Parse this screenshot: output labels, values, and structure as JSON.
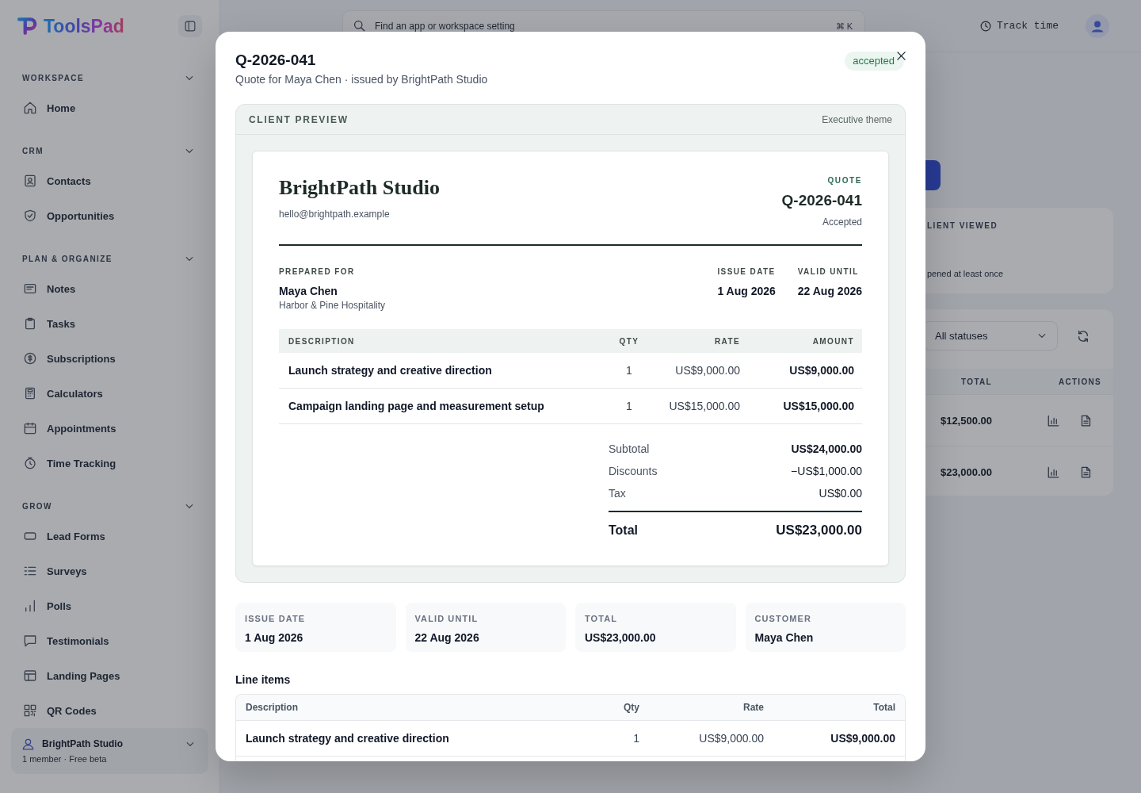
{
  "app": {
    "sidebar": {
      "logo": "ToolsPad",
      "sections": [
        {
          "title": "WORKSPACE",
          "items": [
            {
              "label": "Home",
              "selected": false
            }
          ]
        },
        {
          "title": "CRM",
          "items": [
            {
              "label": "Contacts",
              "selected": false
            },
            {
              "label": "Opportunities",
              "selected": false
            }
          ]
        },
        {
          "title": "PLAN & ORGANIZE",
          "items": [
            {
              "label": "Notes",
              "selected": false
            },
            {
              "label": "Tasks",
              "selected": false
            },
            {
              "label": "Subscriptions",
              "selected": false
            },
            {
              "label": "Calculators",
              "selected": false
            },
            {
              "label": "Appointments",
              "selected": false
            },
            {
              "label": "Time Tracking",
              "selected": false
            }
          ]
        },
        {
          "title": "GROW",
          "items": [
            {
              "label": "Lead Forms",
              "selected": false
            },
            {
              "label": "Surveys",
              "selected": false
            },
            {
              "label": "Polls",
              "selected": false
            },
            {
              "label": "Testimonials",
              "selected": false
            },
            {
              "label": "Landing Pages",
              "selected": false
            },
            {
              "label": "QR Codes",
              "selected": false
            }
          ]
        }
      ],
      "workspace": {
        "name": "BrightPath Studio",
        "meta": "1 member · Free beta"
      }
    },
    "topbar": {
      "search": {
        "placeholder": "Find an app or workspace setting"
      },
      "shortcut": "⌘ K",
      "track_time": "Track time"
    },
    "page": {
      "stat_card": {
        "label": "LIENT VIEWED",
        "caption": "pened at least once"
      },
      "filter": {
        "value": "All statuses"
      },
      "table": {
        "columns": [
          "TOTAL",
          "ACTIONS"
        ],
        "rows": [
          {
            "total": "$12,500.00"
          },
          {
            "total": "$23,000.00"
          }
        ]
      }
    }
  },
  "modal": {
    "title": "Q-2026-041",
    "subtitle": "Quote for Maya Chen · issued by BrightPath Studio",
    "status": "accepted",
    "preview": {
      "heading": "CLIENT PREVIEW",
      "theme": "Executive theme",
      "document": {
        "company": "BrightPath Studio",
        "email": "hello@brightpath.example",
        "doc_type": "QUOTE",
        "number": "Q-2026-041",
        "status": "Accepted",
        "prepared_for": {
          "label": "PREPARED FOR",
          "name": "Maya Chen",
          "company": "Harbor & Pine Hospitality"
        },
        "dates": [
          {
            "label": "ISSUE DATE",
            "value": "1 Aug 2026"
          },
          {
            "label": "VALID UNTIL",
            "value": "22 Aug 2026"
          }
        ],
        "columns": [
          "DESCRIPTION",
          "QTY",
          "RATE",
          "AMOUNT"
        ],
        "items": [
          {
            "description": "Launch strategy and creative direction",
            "qty": "1",
            "rate": "US$9,000.00",
            "amount": "US$9,000.00"
          },
          {
            "description": "Campaign landing page and measurement setup",
            "qty": "1",
            "rate": "US$15,000.00",
            "amount": "US$15,000.00"
          }
        ],
        "totals": [
          {
            "kind": "subtotal",
            "label": "Subtotal",
            "value": "US$24,000.00"
          },
          {
            "kind": "adjustment",
            "label": "Discounts",
            "value": "−US$1,000.00"
          },
          {
            "kind": "adjustment",
            "label": "Tax",
            "value": "US$0.00"
          },
          {
            "kind": "total",
            "label": "Total",
            "value": "US$23,000.00"
          }
        ]
      }
    },
    "summary": [
      {
        "label": "ISSUE DATE",
        "value": "1 Aug 2026"
      },
      {
        "label": "VALID UNTIL",
        "value": "22 Aug 2026"
      },
      {
        "label": "TOTAL",
        "value": "US$23,000.00"
      },
      {
        "label": "CUSTOMER",
        "value": "Maya Chen"
      }
    ],
    "line_items": {
      "title": "Line items",
      "columns": [
        "Description",
        "Qty",
        "Rate",
        "Total"
      ],
      "rows": [
        {
          "description": "Launch strategy and creative direction",
          "qty": "1",
          "rate": "US$9,000.00",
          "total": "US$9,000.00"
        }
      ]
    }
  }
}
